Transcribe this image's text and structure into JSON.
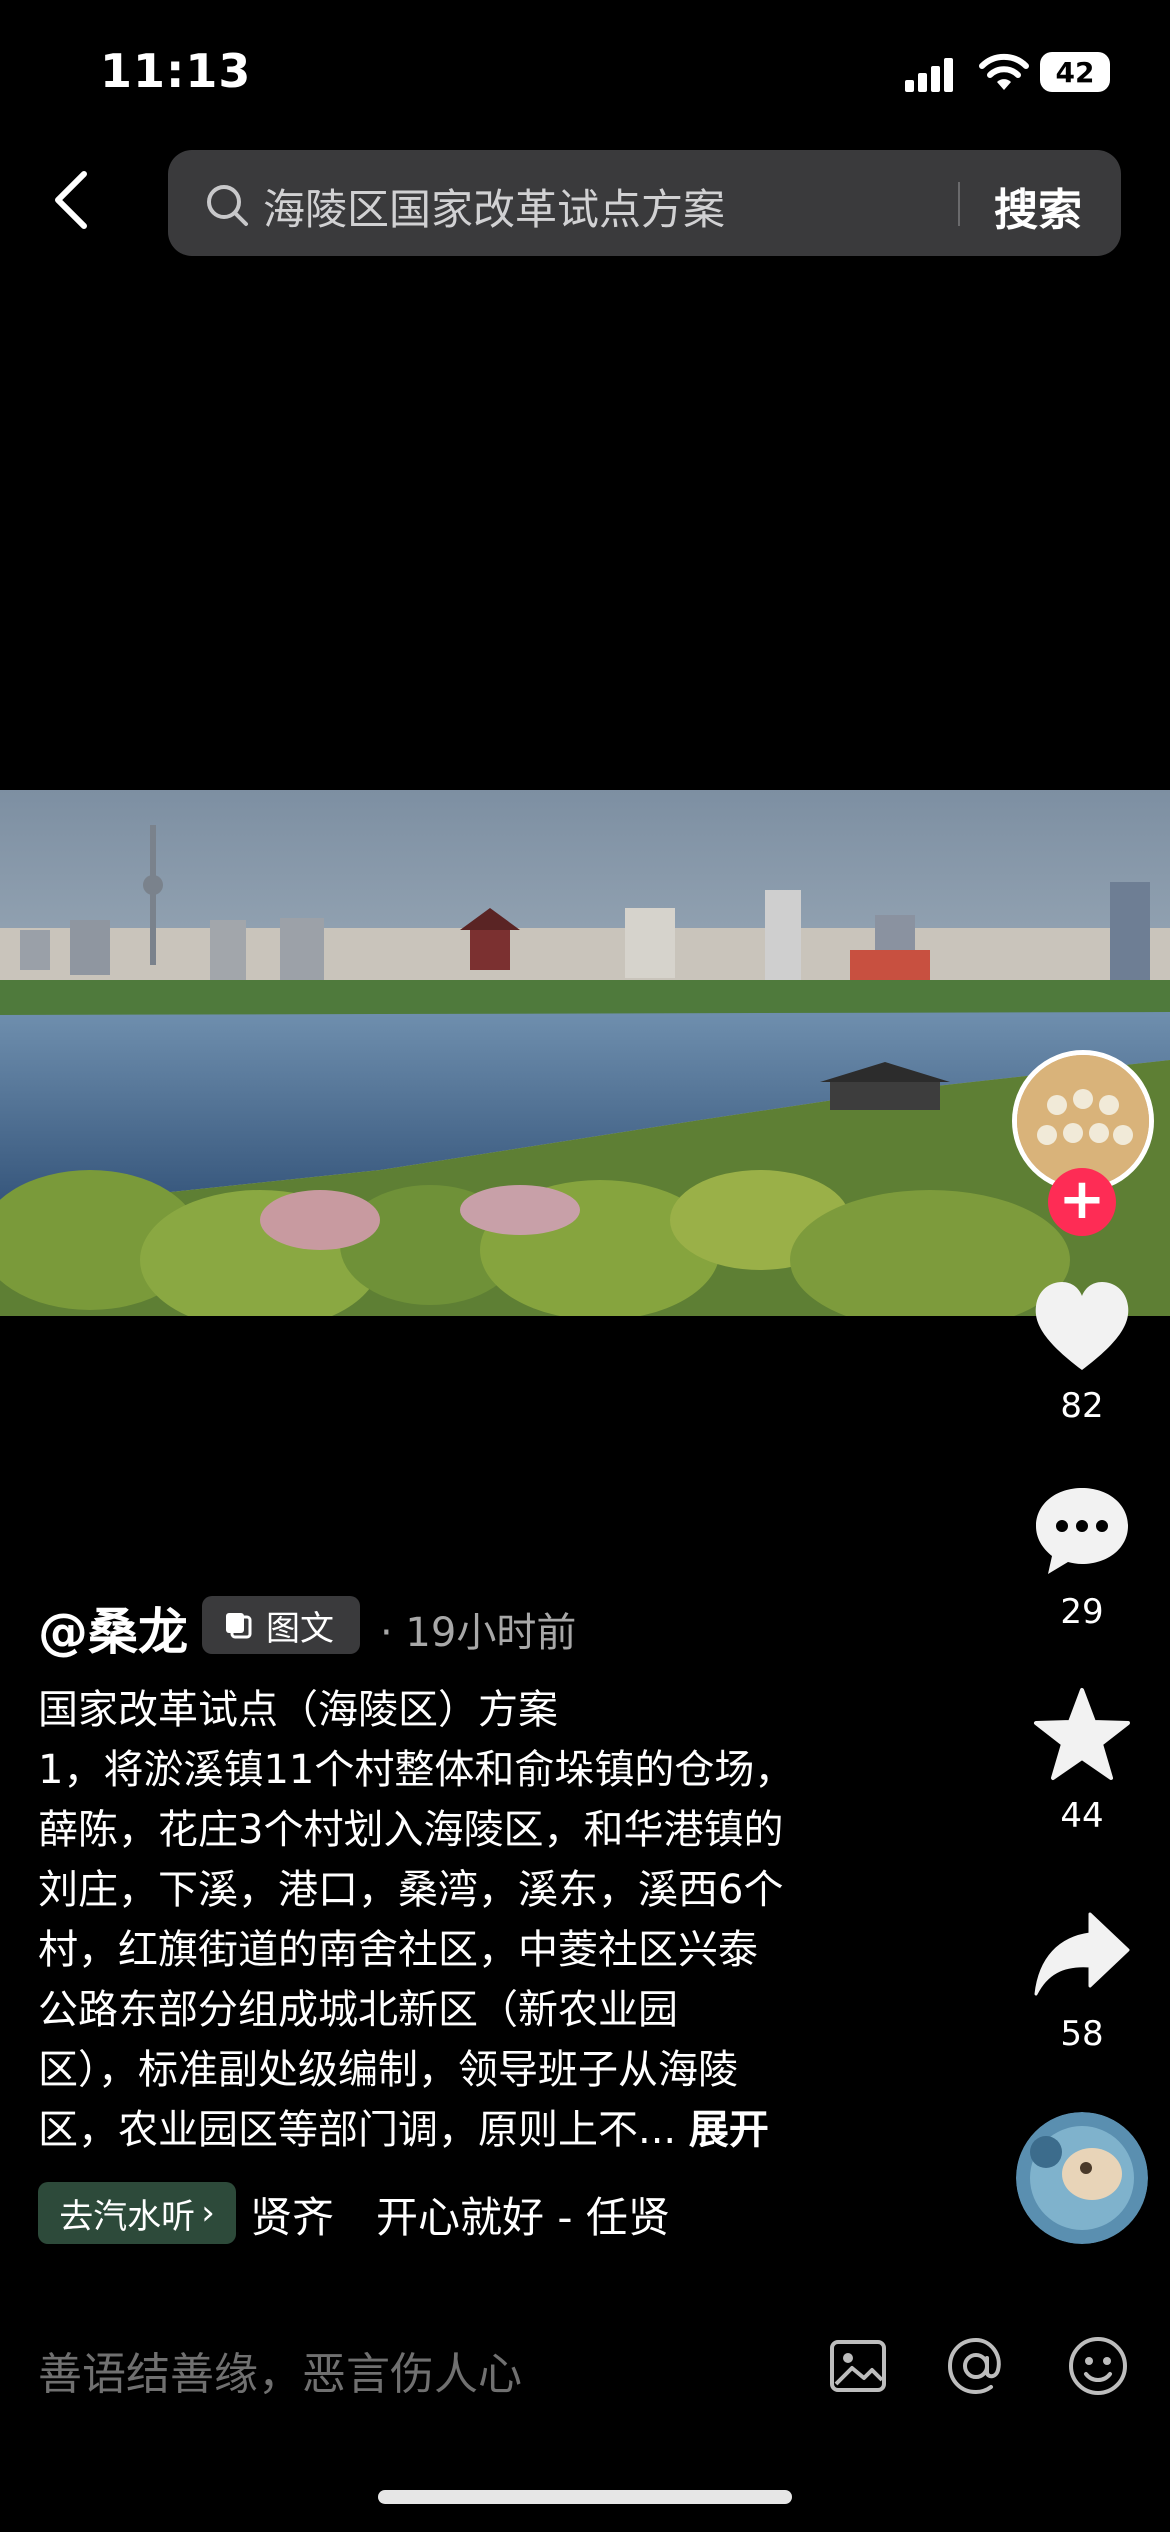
{
  "status_bar": {
    "time": "11:13",
    "battery": "42"
  },
  "search": {
    "query": "海陵区国家改革试点方案",
    "button": "搜索"
  },
  "post": {
    "author": "@桑龙",
    "type_tag": "图文",
    "time_ago": "· 19小时前",
    "description_lines": [
      "国家改革试点（海陵区）方案",
      "1，将淤溪镇11个村整体和俞垛镇的仓场，",
      "薛陈，花庄3个村划入海陵区，和华港镇的",
      "刘庄，下溪，港口，桑湾，溪东，溪西6个",
      "村，红旗街道的南舍社区，中菱社区兴泰",
      "公路东部分组成城北新区（新农业园",
      "区），标准副处级编制，领导班子从海陵",
      "区，农业园区等部门调，原则上不..."
    ],
    "expand": "展开"
  },
  "actions": {
    "likes": "82",
    "comments": "29",
    "favorites": "44",
    "shares": "58"
  },
  "music": {
    "pill": "去汽水听",
    "track": "贤齐　开心就好 - 任贤"
  },
  "comment_input": {
    "placeholder": "善语结善缘，恶言伤人心"
  },
  "colors": {
    "accent": "#fe2c55",
    "background": "#000000"
  },
  "icons": [
    "back-icon",
    "search-icon",
    "heart-icon",
    "comment-icon",
    "star-icon",
    "share-icon",
    "image-icon",
    "at-icon",
    "emoji-icon"
  ]
}
